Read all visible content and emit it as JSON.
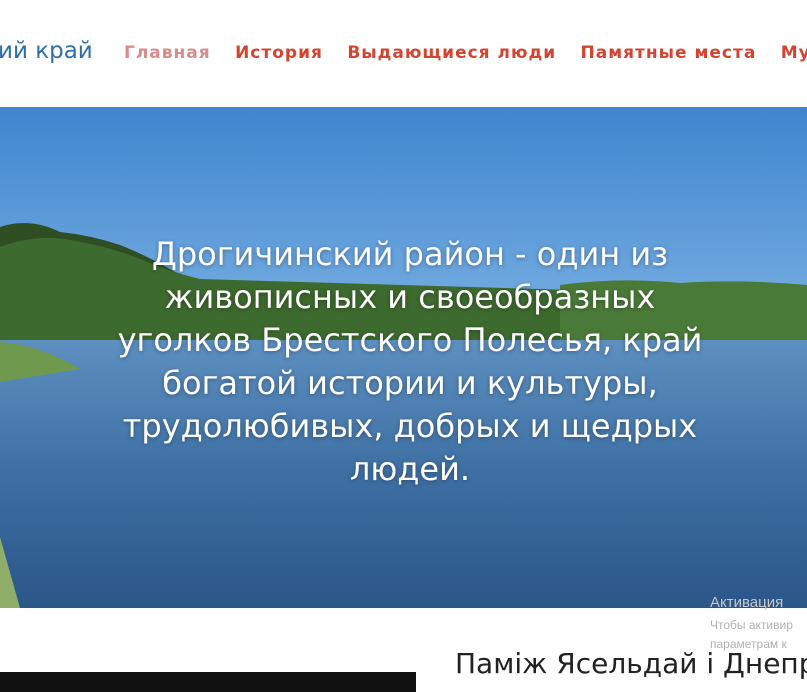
{
  "header": {
    "logo": "ий край",
    "nav": [
      {
        "label": "Главная",
        "active": true
      },
      {
        "label": "История"
      },
      {
        "label": "Выдающиеся люди"
      },
      {
        "label": "Памятные места"
      },
      {
        "label": "Музеи"
      }
    ]
  },
  "hero": {
    "text": "Дрогичинский район - один из живописных и своеобразных уголков Брестского Полесья, край богатой истории и культуры, трудолюбивых, добрых и щедрых людей."
  },
  "watermark": {
    "line1": "Активация",
    "line2": "Чтобы активир",
    "line3": "параметрам к"
  },
  "section": {
    "title": "Паміж Ясельдай і Днепра"
  },
  "colors": {
    "nav": "#d44430",
    "nav_active": "#d98a8a",
    "logo": "#2f6fa8"
  }
}
